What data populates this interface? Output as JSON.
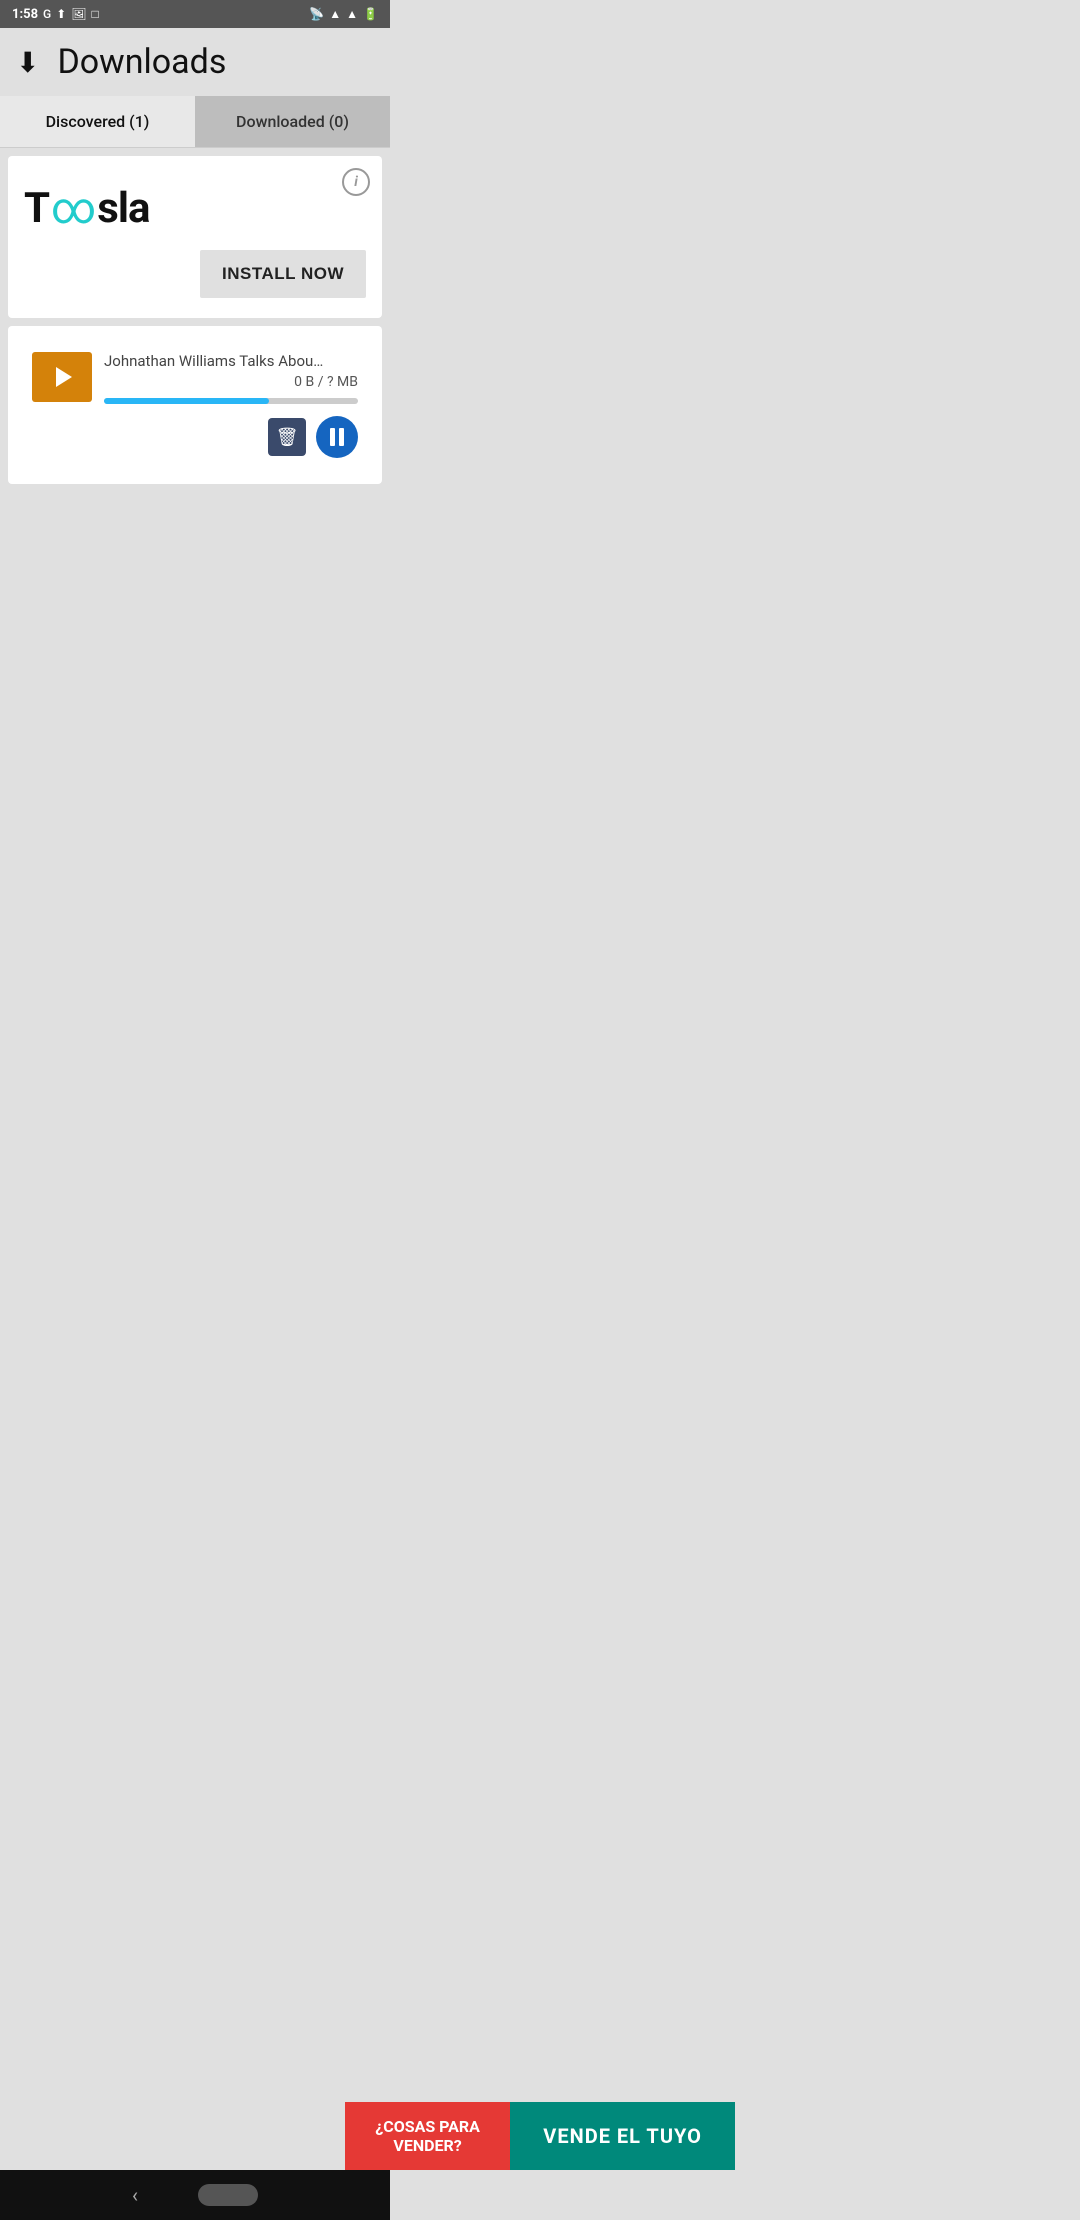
{
  "status_bar": {
    "time": "1:58",
    "icons_left": [
      "google",
      "upload",
      "photo",
      "square"
    ],
    "icons_right": [
      "cast",
      "wifi",
      "signal",
      "battery"
    ]
  },
  "header": {
    "icon": "⬇",
    "title": "Downloads"
  },
  "tabs": [
    {
      "id": "discovered",
      "label": "Discovered (1)",
      "active": true
    },
    {
      "id": "downloaded",
      "label": "Downloaded (0)",
      "active": false
    }
  ],
  "ad_card": {
    "info_label": "i",
    "logo_text_pre": "T",
    "logo_infinity": "∞",
    "logo_text_post": "sla",
    "logo_full": "Toosla",
    "install_button": "INSTALL NOW"
  },
  "download_item": {
    "title": "Johnathan Williams Talks About Playing…",
    "size": "0 B / ? MB",
    "progress_percent": 65,
    "delete_label": "delete",
    "pause_label": "pause"
  },
  "ad_banner": {
    "left_text": "¿COSAS PARA VENDER?",
    "right_text": "VENDE EL TUYO"
  },
  "nav": {
    "back_label": "‹",
    "home_label": ""
  }
}
